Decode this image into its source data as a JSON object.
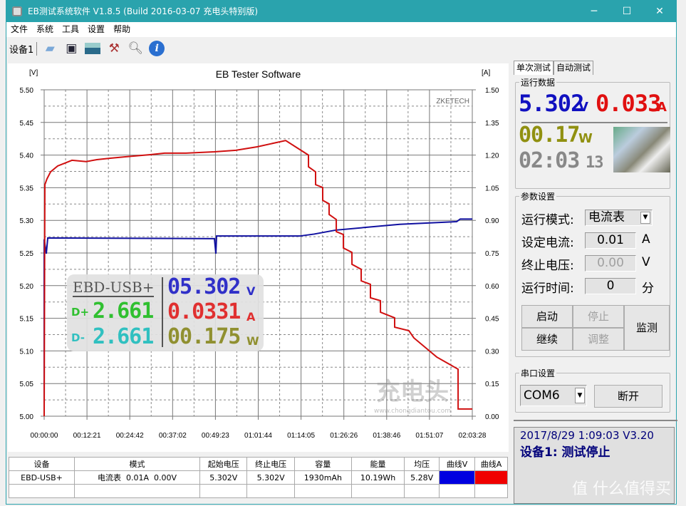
{
  "window": {
    "title": "EB测试系统软件 V1.8.5 (Build 2016-03-07 充电头特别版)",
    "controls": [
      "─",
      "☐",
      "✕"
    ]
  },
  "menu": [
    "文件",
    "系统",
    "工具",
    "设置",
    "帮助"
  ],
  "toolbar": {
    "device_label": "设备1",
    "icons": [
      "folder-icon",
      "save-icon",
      "image-icon",
      "tools-icon",
      "search-icon",
      "info-icon"
    ]
  },
  "chart": {
    "title": "EB Tester Software",
    "left_unit": "[V]",
    "right_unit": "[A]",
    "watermark": "ZKETECH",
    "logo_text": "充电头",
    "logo_url": "www.chongdiantou.com"
  },
  "chart_data": {
    "type": "line",
    "title": "EB Tester Software",
    "ylabel": "[V]",
    "y2label": "[A]",
    "xlim": [
      "00:00:00",
      "02:03:28"
    ],
    "ylim": [
      5.0,
      5.5
    ],
    "y2lim": [
      0,
      1.5
    ],
    "grid": true,
    "x_ticks": [
      "00:00:00",
      "00:12:21",
      "00:24:42",
      "00:37:02",
      "00:49:23",
      "01:01:44",
      "01:14:05",
      "01:26:26",
      "01:38:46",
      "01:51:07",
      "02:03:28"
    ],
    "y_ticks": [
      "5.50",
      "5.45",
      "5.40",
      "5.35",
      "5.30",
      "5.25",
      "5.20",
      "5.15",
      "5.10",
      "5.05",
      "5.00"
    ],
    "y2_ticks": [
      "1.50",
      "1.35",
      "1.20",
      "1.05",
      "0.90",
      "0.75",
      "0.60",
      "0.45",
      "0.30",
      "0.15",
      "0.00"
    ],
    "series": [
      {
        "axis": "left",
        "color": "#1010a0",
        "points": [
          [
            "00:00:00",
            5.271
          ],
          [
            "00:00:37",
            5.249
          ],
          [
            "00:01:02",
            5.273
          ],
          [
            "00:49:06",
            5.272
          ],
          [
            "00:49:31",
            5.249
          ],
          [
            "00:49:43",
            5.276
          ],
          [
            "01:13:45",
            5.276
          ],
          [
            "01:17:52",
            5.279
          ],
          [
            "01:24:01",
            5.285
          ],
          [
            "01:42:31",
            5.294
          ],
          [
            "01:58:57",
            5.298
          ],
          [
            "01:59:59",
            5.302
          ],
          [
            "02:03:28",
            5.302
          ]
        ]
      },
      {
        "axis": "right",
        "color": "#d01010",
        "points": [
          [
            "00:00:00",
            0
          ],
          [
            "00:00:12",
            1.064
          ],
          [
            "00:00:49",
            1.091
          ],
          [
            "00:01:51",
            1.123
          ],
          [
            "00:03:54",
            1.15
          ],
          [
            "00:05:57",
            1.163
          ],
          [
            "00:08:01",
            1.176
          ],
          [
            "00:12:07",
            1.17
          ],
          [
            "00:15:12",
            1.179
          ],
          [
            "00:19:19",
            1.186
          ],
          [
            "00:23:25",
            1.192
          ],
          [
            "00:30:37",
            1.202
          ],
          [
            "00:34:43",
            1.209
          ],
          [
            "00:40:53",
            1.209
          ],
          [
            "00:49:06",
            1.215
          ],
          [
            "00:55:16",
            1.222
          ],
          [
            "01:01:25",
            1.238
          ],
          [
            "01:09:39",
            1.267
          ],
          [
            "01:16:13",
            1.2
          ],
          [
            "01:16:14",
            1.146
          ],
          [
            "01:18:16",
            1.123
          ],
          [
            "01:18:17",
            1.064
          ],
          [
            "01:20:19",
            1.051
          ],
          [
            "01:20:20",
            0.992
          ],
          [
            "01:22:10",
            0.976
          ],
          [
            "01:22:11",
            0.927
          ],
          [
            "01:24:14",
            0.904
          ],
          [
            "01:24:15",
            0.848
          ],
          [
            "01:26:17",
            0.835
          ],
          [
            "01:26:18",
            0.773
          ],
          [
            "01:28:45",
            0.753
          ],
          [
            "01:28:46",
            0.698
          ],
          [
            "01:31:25",
            0.675
          ],
          [
            "01:31:26",
            0.622
          ],
          [
            "01:34:05",
            0.606
          ],
          [
            "01:34:06",
            0.544
          ],
          [
            "01:36:58",
            0.531
          ],
          [
            "01:36:59",
            0.478
          ],
          [
            "01:41:04",
            0.452
          ],
          [
            "01:41:05",
            0.409
          ],
          [
            "01:45:11",
            0.393
          ],
          [
            "01:46:37",
            0.36
          ],
          [
            "01:50:44",
            0.305
          ],
          [
            "01:53:12",
            0.272
          ],
          [
            "01:59:22",
            0.216
          ],
          [
            "01:59:23",
            0.033
          ],
          [
            "02:03:28",
            0.033
          ]
        ]
      }
    ]
  },
  "meter": {
    "device": "EBD-USB+",
    "dp_label": "D+",
    "dm_label": "D-",
    "dp": "2.661",
    "dm": "2.661",
    "voltage": "05.302",
    "voltage_unit": "V",
    "current": "0.0331",
    "current_unit": "A",
    "power": "00.175",
    "power_unit": "W"
  },
  "table": {
    "headers": [
      "设备",
      "模式",
      "起始电压",
      "终止电压",
      "容量",
      "能量",
      "均压",
      "曲线V",
      "曲线A"
    ],
    "rows": [
      [
        "EBD-USB+",
        "电流表  0.01A  0.00V",
        "5.302V",
        "5.302V",
        "1930mAh",
        "10.19Wh",
        "5.28V",
        "",
        ""
      ]
    ],
    "curve_colors": {
      "V": "#0000e0",
      "A": "#f00000"
    }
  },
  "right": {
    "tabs": [
      "单次测试",
      "自动测试"
    ],
    "run_data": {
      "label": "运行数据",
      "voltage": "5.302",
      "voltage_unit": "V",
      "current": "0.033",
      "current_unit": "A",
      "power": "00.17",
      "power_unit": "W",
      "time": "02:03",
      "time_sec": "13"
    },
    "params": {
      "label": "参数设置",
      "mode_label": "运行模式:",
      "mode_value": "电流表",
      "current_label": "设定电流:",
      "current_value": "0.01",
      "current_unit": "A",
      "cutoff_label": "终止电压:",
      "cutoff_value": "0.00",
      "cutoff_unit": "V",
      "time_label": "运行时间:",
      "time_value": "0",
      "time_unit": "分"
    },
    "buttons": {
      "start": "启动",
      "stop": "停止",
      "continue": "继续",
      "adjust": "调整",
      "monitor": "监测"
    },
    "serial": {
      "label": "串口设置",
      "port": "COM6",
      "disconnect": "断开"
    },
    "status": {
      "line1": "2017/8/29 1:09:03  V3.20",
      "line2": "设备1: 测试停止",
      "watermark": "值 什么值得买"
    }
  }
}
